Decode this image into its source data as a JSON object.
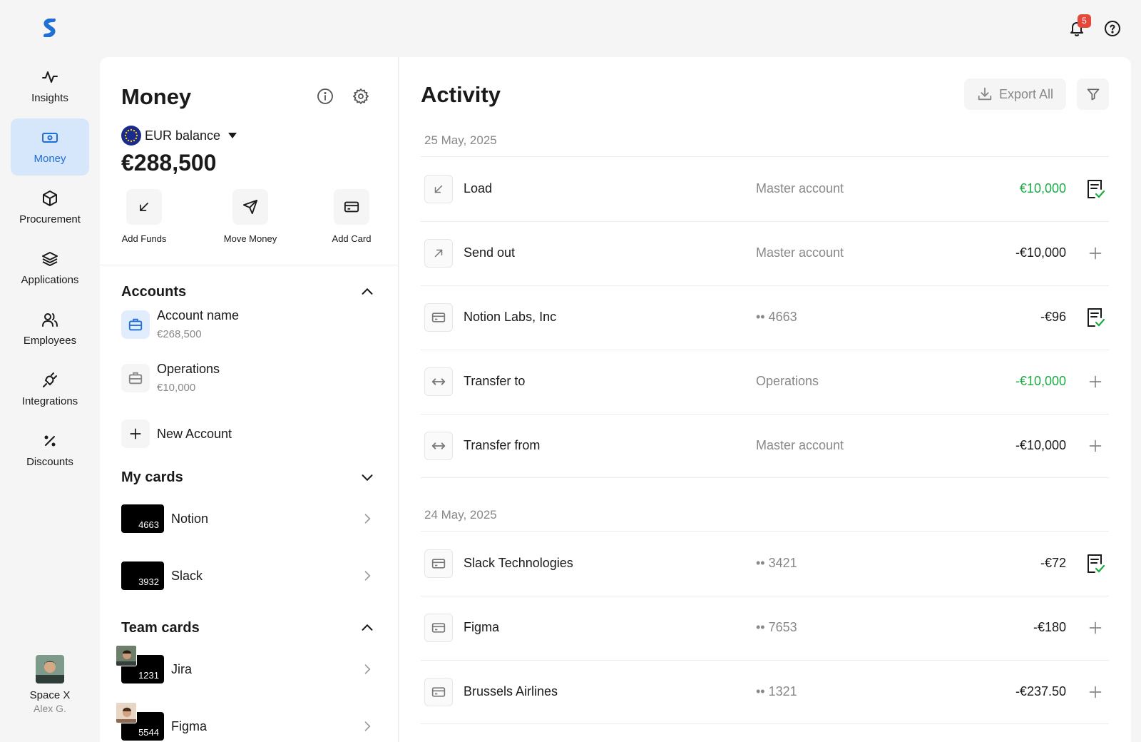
{
  "sidebar": {
    "items": [
      {
        "label": "Insights",
        "icon": "activity-icon"
      },
      {
        "label": "Money",
        "icon": "money-icon",
        "active": true
      },
      {
        "label": "Procurement",
        "icon": "box-icon"
      },
      {
        "label": "Applications",
        "icon": "layers-icon"
      },
      {
        "label": "Employees",
        "icon": "users-icon"
      },
      {
        "label": "Integrations",
        "icon": "plug-icon"
      },
      {
        "label": "Discounts",
        "icon": "percent-icon"
      }
    ],
    "profile": {
      "company": "Space X",
      "user": "Alex G."
    }
  },
  "header": {
    "notifications_count": "5"
  },
  "money": {
    "title": "Money",
    "balance_label": "EUR balance",
    "balance_amount": "€288,500",
    "actions": {
      "add_funds": "Add Funds",
      "move_money": "Move Money",
      "add_card": "Add Card"
    },
    "accounts_heading": "Accounts",
    "accounts": [
      {
        "name": "Account name",
        "balance": "€268,500"
      },
      {
        "name": "Operations",
        "balance": "€10,000"
      }
    ],
    "new_account_label": "New Account",
    "my_cards_heading": "My cards",
    "my_cards": [
      {
        "number": "4663",
        "name": "Notion"
      },
      {
        "number": "3932",
        "name": "Slack"
      }
    ],
    "team_cards_heading": "Team cards",
    "team_cards": [
      {
        "number": "1231",
        "name": "Jira"
      },
      {
        "number": "5544",
        "name": "Figma"
      }
    ]
  },
  "activity": {
    "title": "Activity",
    "export_label": "Export All",
    "groups": [
      {
        "date": "25 May, 2025",
        "transactions": [
          {
            "name": "Load",
            "source": "Master account",
            "amount": "€10,000",
            "amount_color": "#1aab45",
            "icon": "arrow-down-left-icon",
            "action": "receipt-check-icon"
          },
          {
            "name": "Send out",
            "source": "Master account",
            "amount": "-€10,000",
            "icon": "arrow-up-right-icon",
            "action": "plus-icon"
          },
          {
            "name": "Notion Labs, Inc",
            "source": "•• 4663",
            "amount": "-€96",
            "icon": "card-icon",
            "action": "receipt-check-icon"
          },
          {
            "name": "Transfer to",
            "source": "Operations",
            "amount": "-€10,000",
            "amount_color": "#1aab45",
            "icon": "transfer-icon",
            "action": "plus-icon"
          },
          {
            "name": "Transfer from",
            "source": "Master account",
            "amount": "-€10,000",
            "icon": "transfer-icon",
            "action": "plus-icon"
          }
        ]
      },
      {
        "date": "24 May, 2025",
        "transactions": [
          {
            "name": "Slack Technologies",
            "source": "•• 3421",
            "amount": "-€72",
            "icon": "card-icon",
            "action": "receipt-check-icon"
          },
          {
            "name": "Figma",
            "source": "•• 7653",
            "amount": "-€180",
            "icon": "card-icon",
            "action": "plus-icon"
          },
          {
            "name": "Brussels Airlines",
            "source": "•• 1321",
            "amount": "-€237.50",
            "icon": "card-icon",
            "action": "plus-icon"
          }
        ]
      }
    ]
  },
  "colors": {
    "accent": "#1f6fd6",
    "active_bg": "#d6e6fb",
    "positive": "#1aab45",
    "badge": "#e5483a"
  }
}
